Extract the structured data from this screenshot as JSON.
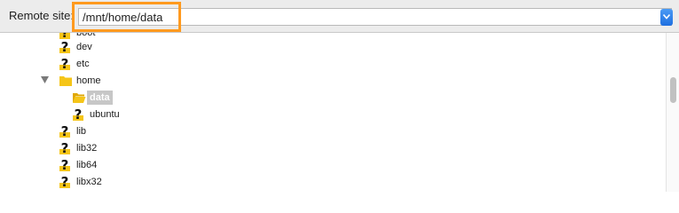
{
  "toolbar": {
    "remote_site_label": "Remote site:",
    "path_value": "/mnt/home/data"
  },
  "tree": {
    "items": [
      {
        "label": "boot",
        "icon": "unknown-folder-icon",
        "level": 1
      },
      {
        "label": "dev",
        "icon": "unknown-folder-icon",
        "level": 1
      },
      {
        "label": "etc",
        "icon": "unknown-folder-icon",
        "level": 1
      },
      {
        "label": "home",
        "icon": "folder-icon",
        "level": 1,
        "expanded": true
      },
      {
        "label": "data",
        "icon": "open-folder-icon",
        "level": 2,
        "selected": true
      },
      {
        "label": "ubuntu",
        "icon": "unknown-folder-icon",
        "level": 2
      },
      {
        "label": "lib",
        "icon": "unknown-folder-icon",
        "level": 1
      },
      {
        "label": "lib32",
        "icon": "unknown-folder-icon",
        "level": 1
      },
      {
        "label": "lib64",
        "icon": "unknown-folder-icon",
        "level": 1
      },
      {
        "label": "libx32",
        "icon": "unknown-folder-icon",
        "level": 1
      }
    ]
  },
  "colors": {
    "highlight": "#ff9a1f",
    "folder": "#f5c518",
    "selection": "#c7c7c7"
  }
}
